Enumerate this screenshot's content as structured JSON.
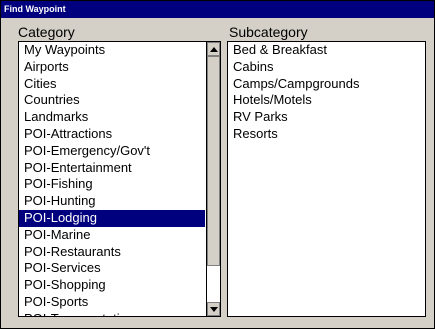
{
  "window": {
    "title": "Find Waypoint"
  },
  "category": {
    "header": "Category",
    "items": [
      "My Waypoints",
      "Airports",
      "Cities",
      "Countries",
      "Landmarks",
      "POI-Attractions",
      "POI-Emergency/Gov't",
      "POI-Entertainment",
      "POI-Fishing",
      "POI-Hunting",
      "POI-Lodging",
      "POI-Marine",
      "POI-Restaurants",
      "POI-Services",
      "POI-Shopping",
      "POI-Sports",
      "POI-Transportation"
    ],
    "selected": "POI-Lodging"
  },
  "subcategory": {
    "header": "Subcategory",
    "items": [
      "Bed & Breakfast",
      "Cabins",
      "Camps/Campgrounds",
      "Hotels/Motels",
      "RV Parks",
      "Resorts"
    ]
  },
  "colors": {
    "titlebar": "#00007f",
    "selection": "#00007f",
    "background": "#d4d0c8"
  },
  "icons": {
    "scroll_up": "up-arrow-icon",
    "scroll_down": "down-arrow-icon"
  }
}
